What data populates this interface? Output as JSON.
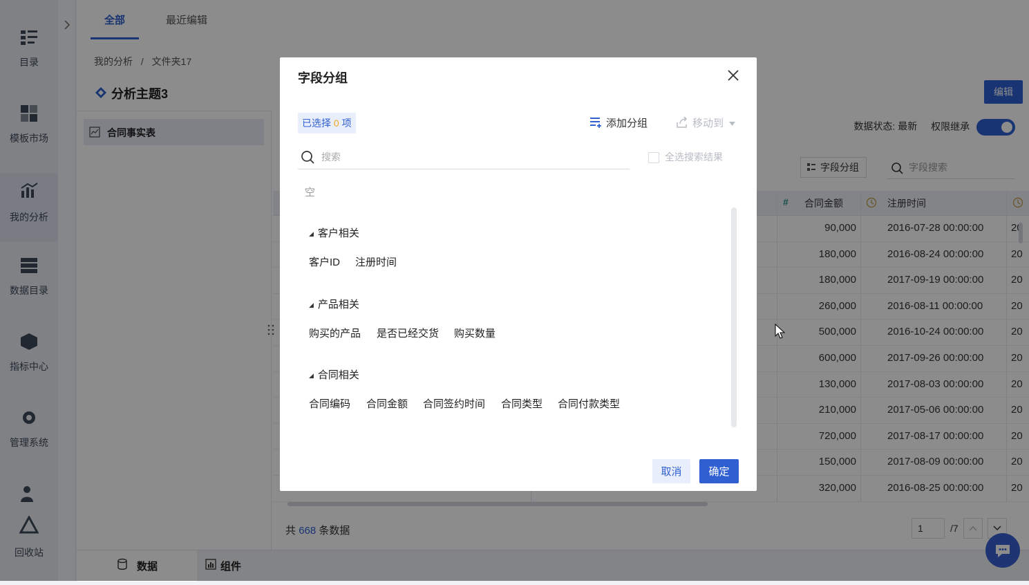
{
  "nav": {
    "items": [
      {
        "label": "目录",
        "icon": "catalog-icon"
      },
      {
        "label": "模板市场",
        "icon": "template-market-icon"
      },
      {
        "label": "我的分析",
        "icon": "my-analysis-icon"
      },
      {
        "label": "数据目录",
        "icon": "data-catalog-icon"
      },
      {
        "label": "指标中心",
        "icon": "metric-center-icon"
      },
      {
        "label": "管理系统",
        "icon": "settings-gear-icon"
      },
      {
        "label": "回收站",
        "icon": "recycle-bin-icon"
      }
    ],
    "active": "我的分析"
  },
  "tabs": [
    {
      "label": "全部"
    },
    {
      "label": "最近编辑"
    }
  ],
  "breadcrumb": {
    "parts": [
      "我的分析",
      "文件夹17"
    ],
    "separator": "/"
  },
  "page": {
    "title": "分析主题3",
    "edit_label": "编辑"
  },
  "tree": {
    "item": "合同事实表"
  },
  "status": {
    "data_state_label": "数据状态: 最新",
    "perm_label": "权限继承",
    "perm_on": true
  },
  "toolbar": {
    "field_group_label": "字段分组",
    "field_search_placeholder": "字段搜索"
  },
  "table": {
    "columns": [
      {
        "type_icon": "#",
        "label": "合同金额"
      },
      {
        "type_icon": "clock-icon",
        "label": "注册时间"
      }
    ],
    "rows": [
      {
        "amount": "90,000",
        "time": "2016-07-28 00:00:00",
        "cut": "20"
      },
      {
        "amount": "180,000",
        "time": "2016-08-24 00:00:00",
        "cut": "20"
      },
      {
        "amount": "180,000",
        "time": "2017-09-19 00:00:00",
        "cut": "20"
      },
      {
        "amount": "260,000",
        "time": "2016-08-11 00:00:00",
        "cut": "20"
      },
      {
        "amount": "500,000",
        "time": "2016-10-24 00:00:00",
        "cut": "20"
      },
      {
        "amount": "600,000",
        "time": "2017-09-26 00:00:00",
        "cut": "20"
      },
      {
        "amount": "130,000",
        "time": "2017-08-03 00:00:00",
        "cut": "20"
      },
      {
        "amount": "210,000",
        "time": "2017-05-06 00:00:00",
        "cut": "20"
      },
      {
        "amount": "720,000",
        "time": "2017-08-17 00:00:00",
        "cut": "20"
      },
      {
        "amount": "150,000",
        "time": "2017-08-09 00:00:00",
        "cut": "20"
      },
      {
        "amount": "320,000",
        "time": "2016-08-25 00:00:00",
        "cut": "20"
      }
    ]
  },
  "footer": {
    "total_prefix": "共",
    "total_count": "668",
    "total_suffix": "条数据",
    "page_value": "1",
    "page_total": "/7"
  },
  "bottom_tabs": [
    {
      "label": "数据"
    },
    {
      "label": "组件"
    }
  ],
  "dialog": {
    "title": "字段分组",
    "selected_prefix": "已选择",
    "selected_count": "0",
    "selected_suffix": "项",
    "add_group_label": "添加分组",
    "move_to_label": "移动到",
    "search_placeholder": "搜索",
    "select_all_label": "全选搜索结果",
    "empty_label": "空",
    "groups": [
      {
        "title": "客户相关",
        "fields": [
          "客户ID",
          "注册时间"
        ]
      },
      {
        "title": "产品相关",
        "fields": [
          "购买的产品",
          "是否已经交货",
          "购买数量"
        ]
      },
      {
        "title": "合同相关",
        "fields": [
          "合同编码",
          "合同金额",
          "合同签约时间",
          "合同类型",
          "合同付款类型"
        ]
      }
    ],
    "cancel_label": "取消",
    "ok_label": "确定"
  },
  "colors": {
    "accent": "#2f5fd0",
    "highlight_count": "#f5a623"
  }
}
